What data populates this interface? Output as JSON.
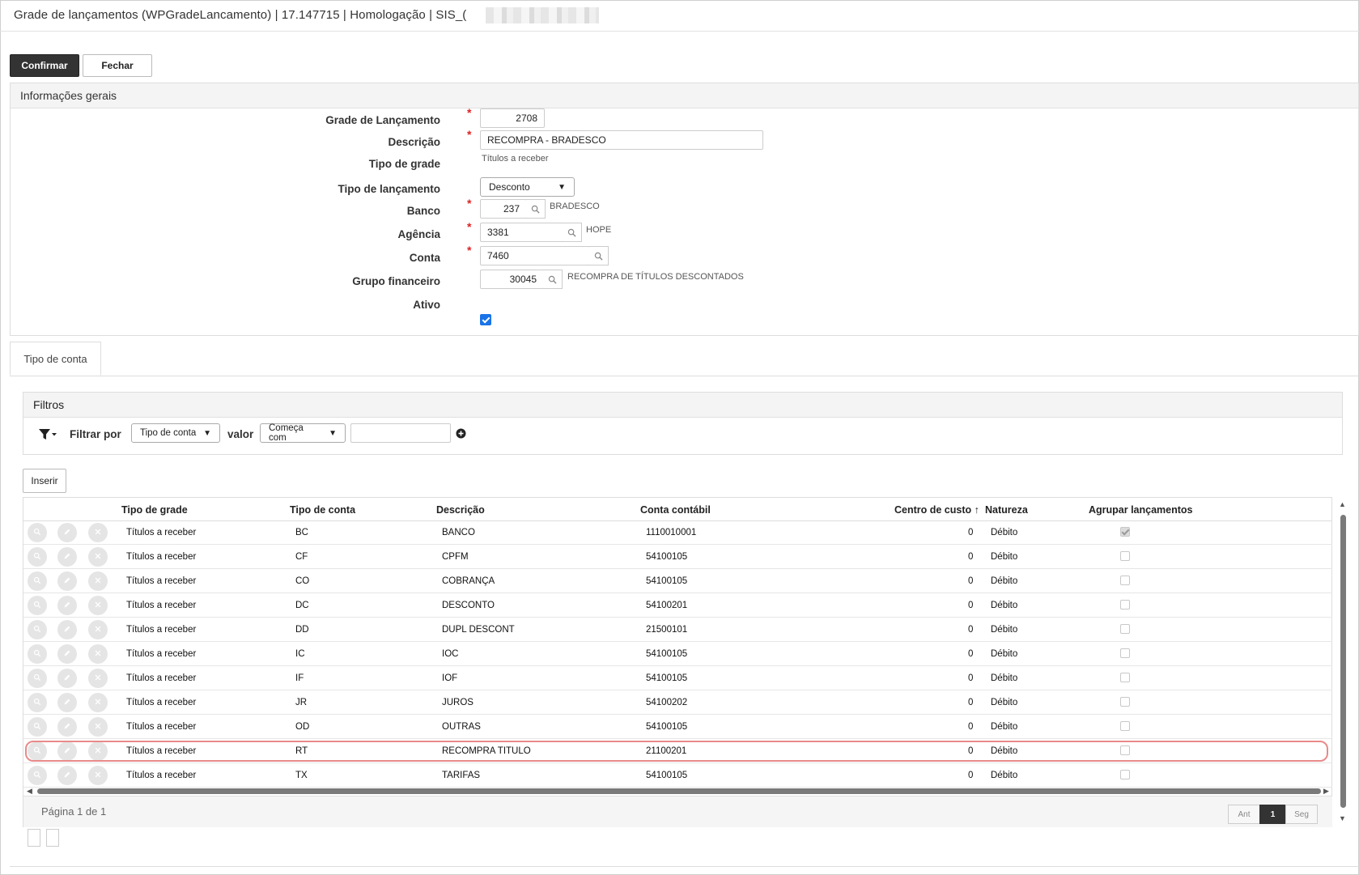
{
  "window": {
    "title": "Grade de lançamentos (WPGradeLancamento) | 17.147715 | Homologação | SIS_("
  },
  "toolbar": {
    "confirm_label": "Confirmar",
    "close_label": "Fechar"
  },
  "general": {
    "header": "Informações gerais",
    "labels": {
      "grade": "Grade de Lançamento",
      "descricao": "Descrição",
      "tipo_grade": "Tipo de grade",
      "tipo_lancamento": "Tipo de lançamento",
      "banco": "Banco",
      "agencia": "Agência",
      "conta": "Conta",
      "grupo": "Grupo financeiro",
      "ativo": "Ativo"
    },
    "values": {
      "grade": "2708",
      "descricao": "RECOMPRA - BRADESCO",
      "tipo_grade": "Títulos a receber",
      "tipo_lancamento": "Desconto",
      "banco": "237",
      "banco_name": "BRADESCO",
      "agencia": "3381",
      "agencia_name": "HOPE",
      "conta": "7460",
      "grupo": "30045",
      "grupo_name": "RECOMPRA DE TÍTULOS DESCONTADOS",
      "ativo": true
    },
    "required_mark": "*"
  },
  "tabs": [
    {
      "label": "Tipo de conta",
      "active": true
    }
  ],
  "filters": {
    "header": "Filtros",
    "filter_by_label": "Filtrar por",
    "field_value": "Tipo de conta",
    "value_label": "valor",
    "operator_value": "Começa com",
    "text_value": ""
  },
  "grid": {
    "insert_label": "Inserir",
    "columns": {
      "tipo_grade": "Tipo de grade",
      "tipo_conta": "Tipo de conta",
      "descricao": "Descrição",
      "conta_contabil": "Conta contábil",
      "centro_custo": "Centro de custo",
      "centro_sort_icon": "↑",
      "natureza": "Natureza",
      "agrupar": "Agrupar lançamentos"
    },
    "rows": [
      {
        "tipo_grade": "Títulos a receber",
        "tipo_conta": "BC",
        "descricao": "BANCO",
        "conta": "1110010001",
        "centro": "0",
        "natureza": "Débito",
        "agrupar": true
      },
      {
        "tipo_grade": "Títulos a receber",
        "tipo_conta": "CF",
        "descricao": "CPFM",
        "conta": "54100105",
        "centro": "0",
        "natureza": "Débito",
        "agrupar": false
      },
      {
        "tipo_grade": "Títulos a receber",
        "tipo_conta": "CO",
        "descricao": "COBRANÇA",
        "conta": "54100105",
        "centro": "0",
        "natureza": "Débito",
        "agrupar": false
      },
      {
        "tipo_grade": "Títulos a receber",
        "tipo_conta": "DC",
        "descricao": "DESCONTO",
        "conta": "54100201",
        "centro": "0",
        "natureza": "Débito",
        "agrupar": false
      },
      {
        "tipo_grade": "Títulos a receber",
        "tipo_conta": "DD",
        "descricao": "DUPL DESCONT",
        "conta": "21500101",
        "centro": "0",
        "natureza": "Débito",
        "agrupar": false
      },
      {
        "tipo_grade": "Títulos a receber",
        "tipo_conta": "IC",
        "descricao": "IOC",
        "conta": "54100105",
        "centro": "0",
        "natureza": "Débito",
        "agrupar": false
      },
      {
        "tipo_grade": "Títulos a receber",
        "tipo_conta": "IF",
        "descricao": "IOF",
        "conta": "54100105",
        "centro": "0",
        "natureza": "Débito",
        "agrupar": false
      },
      {
        "tipo_grade": "Títulos a receber",
        "tipo_conta": "JR",
        "descricao": "JUROS",
        "conta": "54100202",
        "centro": "0",
        "natureza": "Débito",
        "agrupar": false
      },
      {
        "tipo_grade": "Títulos a receber",
        "tipo_conta": "OD",
        "descricao": "OUTRAS",
        "conta": "54100105",
        "centro": "0",
        "natureza": "Débito",
        "agrupar": false
      },
      {
        "tipo_grade": "Títulos a receber",
        "tipo_conta": "RT",
        "descricao": "RECOMPRA TITULO",
        "conta": "21100201",
        "centro": "0",
        "natureza": "Débito",
        "agrupar": false,
        "highlighted": true
      },
      {
        "tipo_grade": "Títulos a receber",
        "tipo_conta": "TX",
        "descricao": "TARIFAS",
        "conta": "54100105",
        "centro": "0",
        "natureza": "Débito",
        "agrupar": false
      }
    ],
    "pager": {
      "text": "Página 1 de 1",
      "prev": "Ant",
      "current": "1",
      "next": "Seg"
    }
  },
  "colors": {
    "primary_button": "#333333",
    "checkbox_checked": "#1a73e8",
    "highlight": "#e88a8a",
    "required": "#dd2222"
  }
}
